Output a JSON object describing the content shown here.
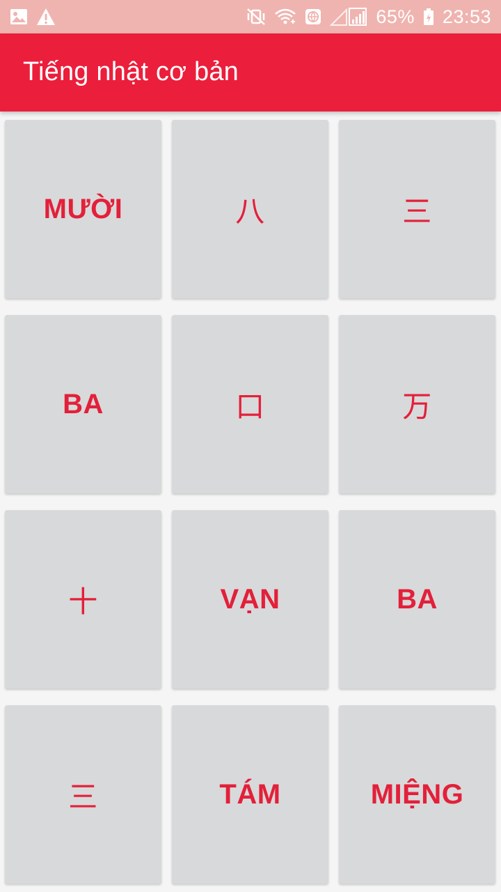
{
  "status_bar": {
    "left_icons": [
      "image-icon",
      "warning-icon"
    ],
    "right_icons": [
      "mute-vibrate-icon",
      "wifi-icon",
      "vpn-globe-icon",
      "signal-icon",
      "battery-icon"
    ],
    "battery_percent": "65%",
    "time": "23:53",
    "background_color": "#efb4b0"
  },
  "app_bar": {
    "title": "Tiếng nhật cơ bản",
    "background_color": "#eb1e3b"
  },
  "tiles": [
    {
      "label": "MƯỜI",
      "type": "word"
    },
    {
      "label": "八",
      "type": "kanji"
    },
    {
      "label": "三",
      "type": "kanji"
    },
    {
      "label": "BA",
      "type": "word"
    },
    {
      "label": "口",
      "type": "kanji"
    },
    {
      "label": "万",
      "type": "kanji"
    },
    {
      "label": "十",
      "type": "kanji"
    },
    {
      "label": "VẠN",
      "type": "word"
    },
    {
      "label": "BA",
      "type": "word"
    },
    {
      "label": "三",
      "type": "kanji"
    },
    {
      "label": "TÁM",
      "type": "word"
    },
    {
      "label": "MIỆNG",
      "type": "word"
    }
  ],
  "colors": {
    "tile_background": "#d8d9da",
    "tile_text": "#e3203a"
  }
}
